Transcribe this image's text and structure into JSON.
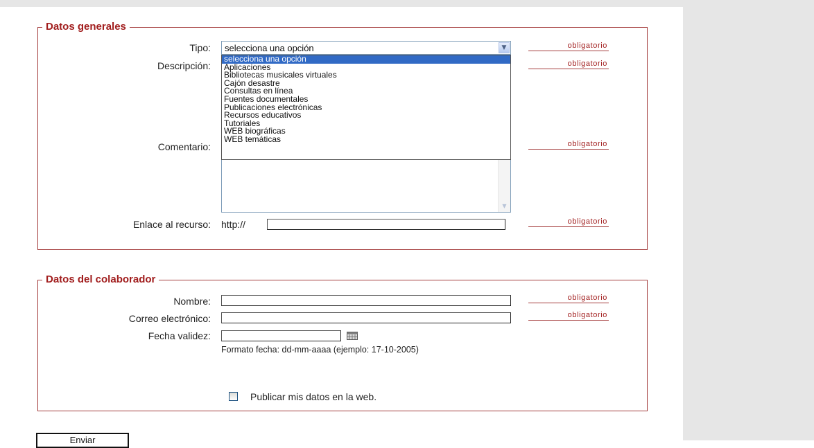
{
  "required_label": "obligatorio",
  "section_general": {
    "legend": "Datos generales",
    "tipo_label": "Tipo:",
    "tipo_selected": "selecciona una opción",
    "tipo_options": [
      "selecciona una opción",
      "Aplicaciones",
      "Bibliotecas musicales virtuales",
      "Cajón desastre",
      "Consultas en línea",
      "Fuentes documentales",
      "Publicaciones electrónicas",
      "Recursos educativos",
      "Tutoriales",
      "WEB biográficas",
      "WEB temáticas"
    ],
    "descripcion_label": "Descripción:",
    "comentario_label": "Comentario:",
    "enlace_label": "Enlace al recurso:",
    "enlace_prefix": "http://",
    "enlace_value": ""
  },
  "section_colaborador": {
    "legend": "Datos del colaborador",
    "nombre_label": "Nombre:",
    "nombre_value": "",
    "correo_label": "Correo electrónico:",
    "correo_value": "",
    "fecha_label": "Fecha validez:",
    "fecha_value": "",
    "fecha_hint": "Formato fecha: dd-mm-aaaa (ejemplo: 17-10-2005)",
    "publicar_label": "Publicar mis datos en la web."
  },
  "submit_label": "Enviar",
  "colors": {
    "accent": "#a11d1d",
    "panel": "#e6e6e6",
    "selection": "#316ac5"
  }
}
